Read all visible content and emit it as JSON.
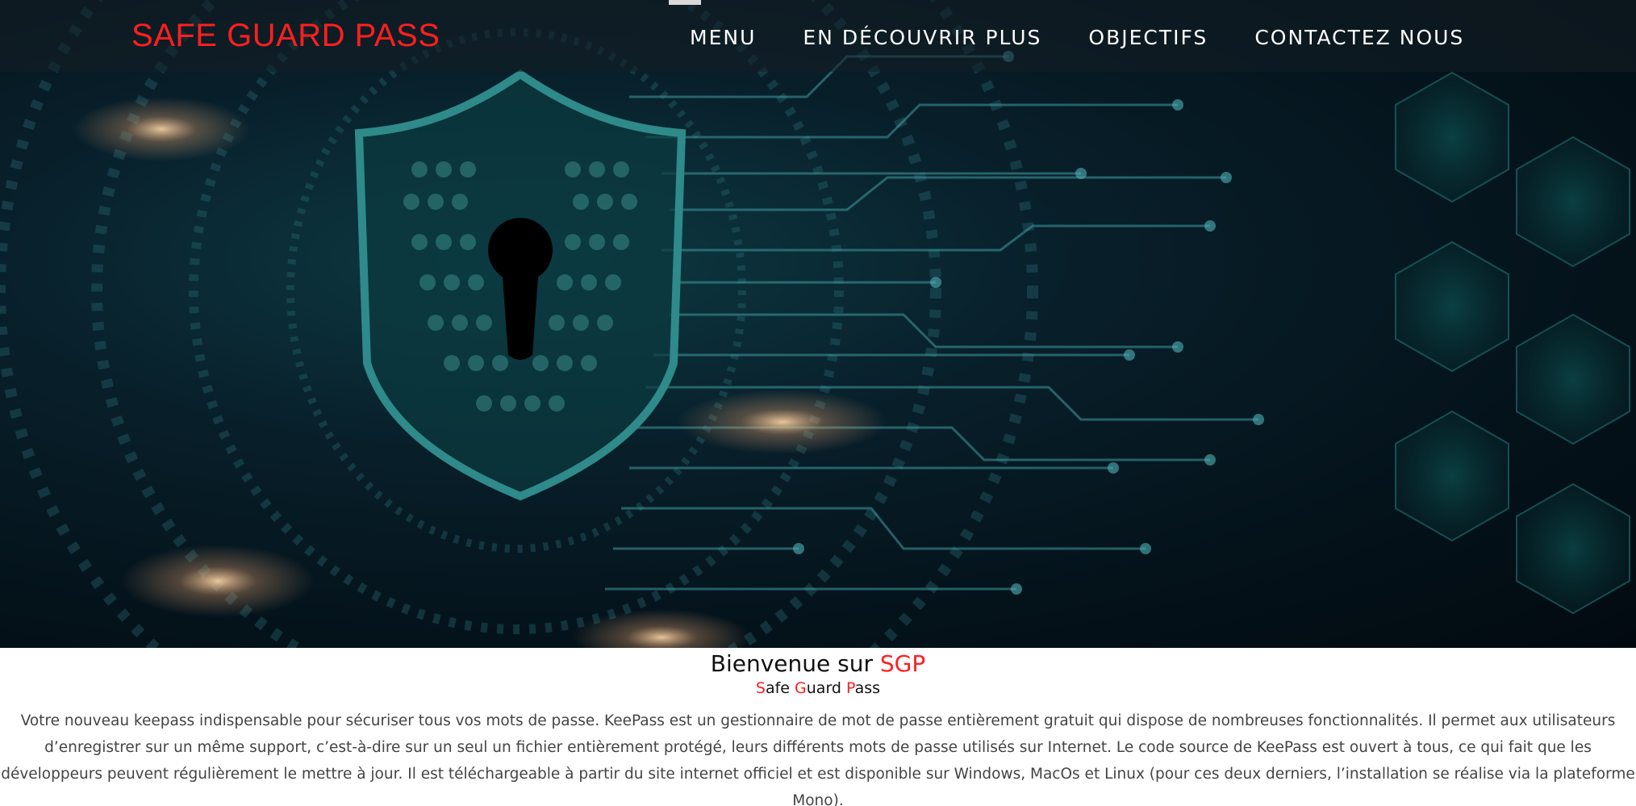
{
  "header": {
    "brand": "SAFE GUARD PASS",
    "nav": [
      "MENU",
      "EN DÉCOUVRIR PLUS",
      "OBJECTIFS",
      "CONTACTEZ NOUS"
    ]
  },
  "intro": {
    "welcome_prefix": "Bienvenue sur ",
    "welcome_highlight": "SGP",
    "subtitle_parts": [
      {
        "letter": "S",
        "rest": "afe "
      },
      {
        "letter": "G",
        "rest": "uard "
      },
      {
        "letter": "P",
        "rest": "ass"
      }
    ],
    "description": "Votre nouveau keepass indispensable pour sécuriser tous vos mots de passe. KeePass est un gestionnaire de mot de passe entièrement gratuit qui dispose de nombreuses fonctionnalités. Il permet aux utilisateurs d’enregistrer sur un même support, c’est-à-dire sur un seul un fichier entièrement protégé, leurs différents mots de passe utilisés sur Internet. Le code source de KeePass est ouvert à tous, ce qui fait que les développeurs peuvent régulièrement le mettre à jour. Il est téléchargeable à partir du site internet officiel et est disponible sur Windows, MacOs et Linux (pour ces deux derniers, l’installation se réalise via la plateforme Mono)."
  },
  "colors": {
    "accent": "#ff1f1f",
    "hero_dark": "#04121a",
    "hero_teal": "#0d4a50"
  }
}
